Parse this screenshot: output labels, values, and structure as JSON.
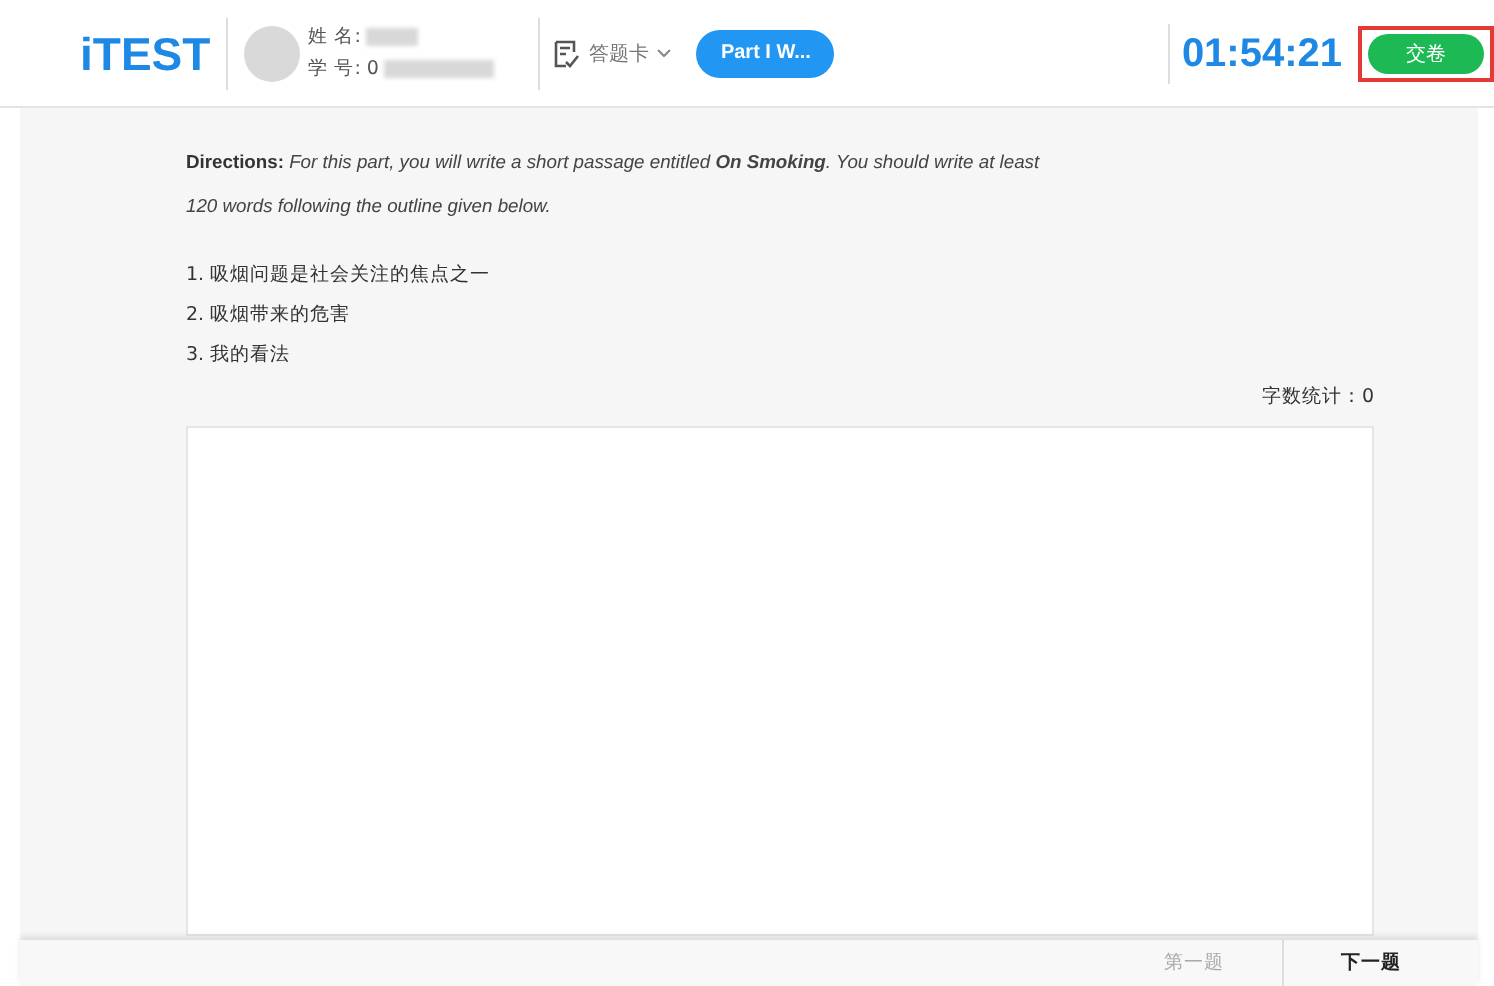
{
  "header": {
    "logo": "iTEST",
    "name_label": "姓 名:",
    "id_label": "学 号:",
    "id_value": "0",
    "answer_card": "答题卡",
    "part_button": "Part I W...",
    "timer": "01:54:21",
    "submit_button": "交卷"
  },
  "directions": {
    "label": "Directions:",
    "text": "For this part, you will write a short passage entitled **On Smoking**. You should write at least 120 words following the outline given below."
  },
  "outline": [
    "1. 吸烟问题是社会关注的焦点之一",
    "2. 吸烟带来的危害",
    "3. 我的看法"
  ],
  "word_count": {
    "label": "字数统计：",
    "value": "0"
  },
  "footer": {
    "buttons": [
      {
        "label": "第一题",
        "disabled": true
      },
      {
        "label": "下一题",
        "disabled": false
      }
    ]
  }
}
